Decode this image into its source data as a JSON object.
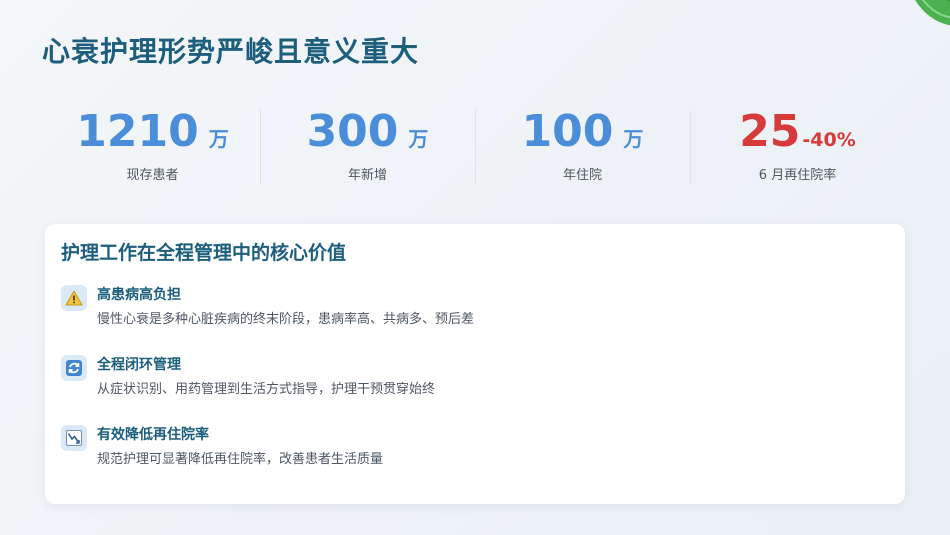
{
  "page": {
    "title": "心衰护理形势严峻且意义重大"
  },
  "stats": [
    {
      "number": "1210",
      "unit": "万",
      "label": "现存患者",
      "color": "#4a8ed9"
    },
    {
      "number": "300",
      "unit": "万",
      "label": "年新增",
      "color": "#4a8ed9"
    },
    {
      "number": "100",
      "unit": "万",
      "label": "年住院",
      "color": "#4a8ed9"
    },
    {
      "number": "25",
      "unit": "-40%",
      "label": "6 月再住院率",
      "color": "#d63a3a"
    }
  ],
  "card": {
    "title": "护理工作在全程管理中的核心价值",
    "items": [
      {
        "icon": "warning-icon",
        "title": "高患病高负担",
        "desc": "慢性心衰是多种心脏疾病的终末阶段，患病率高、共病多、预后差"
      },
      {
        "icon": "cycle-icon",
        "title": "全程闭环管理",
        "desc": "从症状识别、用药管理到生活方式指导，护理干预贯穿始终"
      },
      {
        "icon": "trend-down-icon",
        "title": "有效降低再住院率",
        "desc": "规范护理可显著降低再住院率，改善患者生活质量"
      }
    ]
  },
  "colors": {
    "title": "#1c5e7c",
    "accent_blue": "#4a8ed9",
    "alert_red": "#d63a3a",
    "icon_bg": "#dbe8f6"
  },
  "decoration": {
    "corner_icon": "leaf-icon"
  }
}
